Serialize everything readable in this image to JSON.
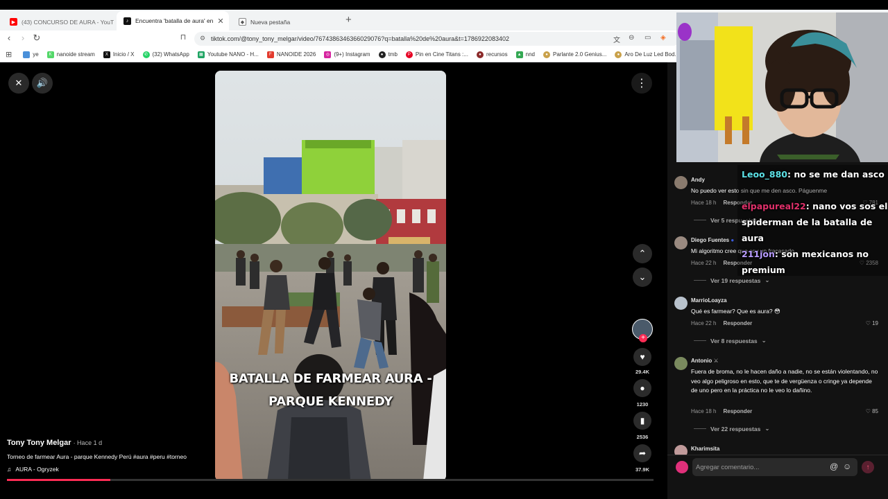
{
  "browser": {
    "tabs": [
      {
        "title": "(43) CONCURSO DE AURA - YouT",
        "active": false
      },
      {
        "title": "Encuentra 'batalla de aura' en",
        "active": true
      },
      {
        "title": "Nueva pestaña",
        "active": false
      }
    ],
    "url": "tiktok.com/@tony_tony_melgar/video/7674386346366029076?q=batalla%20de%20aura&t=1786922083402",
    "bookmarks": [
      {
        "label": "ye",
        "color": "#4a90d9"
      },
      {
        "label": "nanoide stream",
        "color": "#53d769"
      },
      {
        "label": "Inicio / X",
        "color": "#111111"
      },
      {
        "label": "(32) WhatsApp",
        "color": "#25d366"
      },
      {
        "label": "Youtube NANO - H...",
        "color": "#1fa463"
      },
      {
        "label": "NANOIDE 2026",
        "color": "#e33b2e"
      },
      {
        "label": "(9+) Instagram",
        "color": "#d6249f"
      },
      {
        "label": "tmb",
        "color": "#222222"
      },
      {
        "label": "Pin en Cine Titans :...",
        "color": "#e60023"
      },
      {
        "label": "recursos",
        "color": "#8b2a2a"
      },
      {
        "label": "nnd",
        "color": "#34a853"
      },
      {
        "label": "Parlante 2.0 Genius...",
        "color": "#c9a14a"
      },
      {
        "label": "Aro De Luz Led Bod...",
        "color": "#c9a14a"
      }
    ]
  },
  "video": {
    "caption_line1": "BATALLA DE FARMEAR AURA -",
    "caption_line2": "PARQUE KENNEDY",
    "author": "Tony Tony Melgar",
    "posted": "· Hace 1 d",
    "description": "Torneo de farmear Aura - parque Kennedy Perú #aura #peru #torneo",
    "music": "AURA - Ogryzek",
    "progress": 0.16
  },
  "actions": {
    "likes": "29.4K",
    "comments": "1230",
    "saves": "2536",
    "shares": "37.9K"
  },
  "comments": [
    {
      "user": "Andy",
      "text": "No puedo ver esto sin que me den asco. Páguenme",
      "time": "Hace 18 h",
      "reply": "Responder",
      "likes": "781",
      "more": "Ver 5 respuestas"
    },
    {
      "user": "Diego Fuentes",
      "text": "Mi algoritmo cree que soy un fracasado",
      "time": "Hace 22 h",
      "reply": "Responder",
      "likes": "2358",
      "more": "Ver 19 respuestas"
    },
    {
      "user": "MarrioLoayza",
      "text": "Qué es farmear? Que es aura? 😳",
      "time": "Hace 22 h",
      "reply": "Responder",
      "likes": "19",
      "more": "Ver 8 respuestas"
    },
    {
      "user": "Antonio",
      "text": "Fuera de broma, no le hacen daño a nadie, no se están violentando, no veo algo peligroso en esto, que te de vergüenza o cringe ya depende de uno pero en la práctica no le veo lo dañino.",
      "time": "Hace 18 h",
      "reply": "Responder",
      "likes": "85",
      "more": "Ver 22 respuestas"
    },
    {
      "user": "Kharimsita"
    }
  ],
  "comment_input": {
    "placeholder": "Agregar comentario..."
  },
  "chat": [
    {
      "user": "Leoo_880",
      "color": "#5ce1e6",
      "message": "no se me dan asco"
    },
    {
      "user": "elpapureal22",
      "color": "#e0306a",
      "message": "nano vos sos el spiderman de la batalla de aura"
    },
    {
      "user": "211jon",
      "color": "#b89cff",
      "message": "son mexicanos no premium"
    }
  ]
}
